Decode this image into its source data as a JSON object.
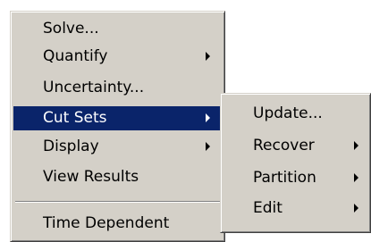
{
  "main_menu": {
    "items": [
      {
        "label": "Solve...",
        "has_submenu": false
      },
      {
        "label": "Quantify",
        "has_submenu": true
      },
      {
        "label": "Uncertainty...",
        "has_submenu": false
      },
      {
        "label": "Cut Sets",
        "has_submenu": true,
        "selected": true
      },
      {
        "label": "Display",
        "has_submenu": true
      },
      {
        "label": "View Results",
        "has_submenu": false
      },
      {
        "label": "Time Dependent",
        "has_submenu": false
      }
    ]
  },
  "sub_menu": {
    "parent": "Cut Sets",
    "items": [
      {
        "label": "Update...",
        "has_submenu": false
      },
      {
        "label": "Recover",
        "has_submenu": true
      },
      {
        "label": "Partition",
        "has_submenu": true
      },
      {
        "label": "Edit",
        "has_submenu": true
      }
    ]
  },
  "colors": {
    "menu_background": "#d4d0c8",
    "highlight_background": "#0a246a",
    "highlight_text": "#ffffff",
    "text": "#000000"
  }
}
